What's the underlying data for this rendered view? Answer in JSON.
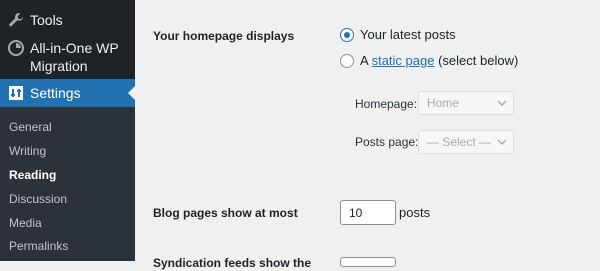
{
  "sidebar": {
    "menu": [
      {
        "label": "Tools",
        "icon": "wrench-icon"
      },
      {
        "label": "All-in-One WP Migration",
        "icon": "migration-icon"
      },
      {
        "label": "Settings",
        "icon": "settings-icon"
      }
    ],
    "submenu": [
      "General",
      "Writing",
      "Reading",
      "Discussion",
      "Media",
      "Permalinks"
    ],
    "current_submenu": "Reading"
  },
  "main": {
    "homepage_displays": {
      "label": "Your homepage displays",
      "option_latest": "Your latest posts",
      "option_static_prefix": "A",
      "option_static_link": "static page",
      "option_static_suffix": "(select below)",
      "selected": "latest"
    },
    "homepage_select": {
      "label": "Homepage:",
      "value": "Home"
    },
    "posts_page_select": {
      "label": "Posts page:",
      "value": "— Select —"
    },
    "blog_pages": {
      "label": "Blog pages show at most",
      "value": "10",
      "unit": "posts"
    },
    "syndication": {
      "label": "Syndication feeds show the"
    }
  },
  "colors": {
    "sidebar_bg": "#1d2327",
    "submenu_bg": "#2c3338",
    "accent": "#2271b1",
    "content_bg": "#f0f0f1"
  }
}
